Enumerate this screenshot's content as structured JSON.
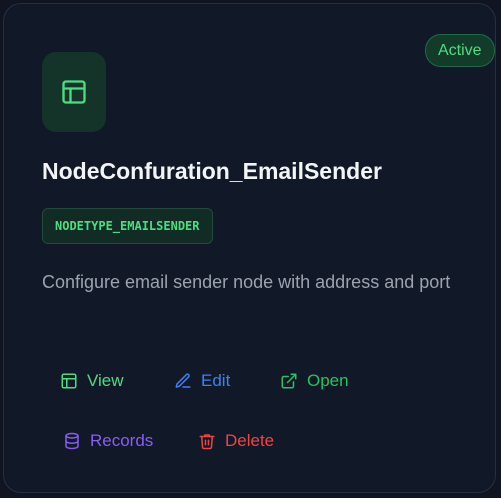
{
  "card": {
    "status": "Active",
    "icon": "layout-icon",
    "title": "NodeConfuration_EmailSender",
    "code": "NODETYPE_EMAILSENDER",
    "description": "Configure email sender node with address and port"
  },
  "actions": {
    "view": {
      "label": "View",
      "icon": "layout-icon",
      "color": "#4ade80"
    },
    "edit": {
      "label": "Edit",
      "icon": "edit-icon",
      "color": "#3b82f6"
    },
    "open": {
      "label": "Open",
      "icon": "external-link-icon",
      "color": "#22c55e"
    },
    "records": {
      "label": "Records",
      "icon": "database-icon",
      "color": "#8b5cf6"
    },
    "delete": {
      "label": "Delete",
      "icon": "trash-icon",
      "color": "#ef4444"
    }
  },
  "colors": {
    "background": "#101521",
    "card": "#111827",
    "accent": "#4ade80",
    "text": "#f3f4f6",
    "muted": "#9ca3af"
  }
}
